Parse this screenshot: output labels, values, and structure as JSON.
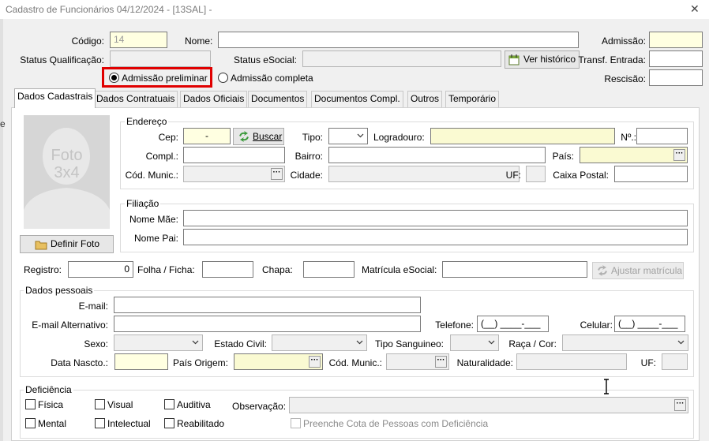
{
  "window": {
    "title": "Cadastro de Funcionários  04/12/2024 - [13SAL] -",
    "close_glyph": "✕"
  },
  "header": {
    "codigo_label": "Código:",
    "codigo_value": "14",
    "nome_label": "Nome:",
    "admissao_label": "Admissão:",
    "status_qualificacao_label": "Status Qualificação:",
    "status_esocial_label": "Status eSocial:",
    "ver_historico_label": "Ver histórico",
    "transf_entrada_label": "Transf. Entrada:",
    "rescisao_label": "Rescisão:",
    "radio_preliminar": "Admissão preliminar",
    "radio_completa": "Admissão completa",
    "radio_selected": "preliminar"
  },
  "tabs": [
    {
      "label": "Dados Cadastrais",
      "active": true
    },
    {
      "label": "Dados Contratuais",
      "active": false
    },
    {
      "label": "Dados Oficiais",
      "active": false
    },
    {
      "label": "Documentos",
      "active": false
    },
    {
      "label": "Documentos Compl.",
      "active": false
    },
    {
      "label": "Outros",
      "active": false
    },
    {
      "label": "Temporário",
      "active": false
    }
  ],
  "photo": {
    "placeholder_line1": "Foto",
    "placeholder_line2": "3x4",
    "definir_foto_label": "Definir Foto"
  },
  "endereco": {
    "group_label": "Endereço",
    "cep_label": "Cep:",
    "cep_value": "-",
    "buscar_label": "Buscar",
    "tipo_label": "Tipo:",
    "logradouro_label": "Logradouro:",
    "numero_label": "Nº.:",
    "compl_label": "Compl.:",
    "bairro_label": "Bairro:",
    "pais_label": "País:",
    "cod_munic_label": "Cód. Munic.:",
    "cidade_label": "Cidade:",
    "uf_label": "UF:",
    "caixa_postal_label": "Caixa Postal:"
  },
  "filiacao": {
    "group_label": "Filiação",
    "nome_mae_label": "Nome Mãe:",
    "nome_pai_label": "Nome Pai:"
  },
  "registro": {
    "registro_label": "Registro:",
    "registro_value": "0",
    "folha_label": "Folha / Ficha:",
    "chapa_label": "Chapa:",
    "matricula_label": "Matrícula eSocial:",
    "ajustar_label": "Ajustar matrícula"
  },
  "dados_pessoais": {
    "group_label": "Dados pessoais",
    "email_label": "E-mail:",
    "email_alt_label": "E-mail Alternativo:",
    "telefone_label": "Telefone:",
    "telefone_mask": "(__) ____-___",
    "celular_label": "Celular:",
    "celular_mask": "(__) ____-___",
    "sexo_label": "Sexo:",
    "estado_civil_label": "Estado Civil:",
    "tipo_sanguineo_label": "Tipo Sanguineo:",
    "raca_label": "Raça / Cor:",
    "data_nascto_label": "Data Nascto.:",
    "pais_origem_label": "País Origem:",
    "cod_munic_label": "Cód. Munic.:",
    "naturalidade_label": "Naturalidade:",
    "uf_label": "UF:"
  },
  "deficiencia": {
    "group_label": "Deficiência",
    "fisica": "Física",
    "visual": "Visual",
    "auditiva": "Auditiva",
    "mental": "Mental",
    "intelectual": "Intelectual",
    "reabilitado": "Reabilitado",
    "observacao_label": "Observação:",
    "cota_label": "Preenche Cota de Pessoas com Deficiência"
  },
  "colors": {
    "highlight_border": "#e00000",
    "yellow_field": "#ffffe1"
  }
}
